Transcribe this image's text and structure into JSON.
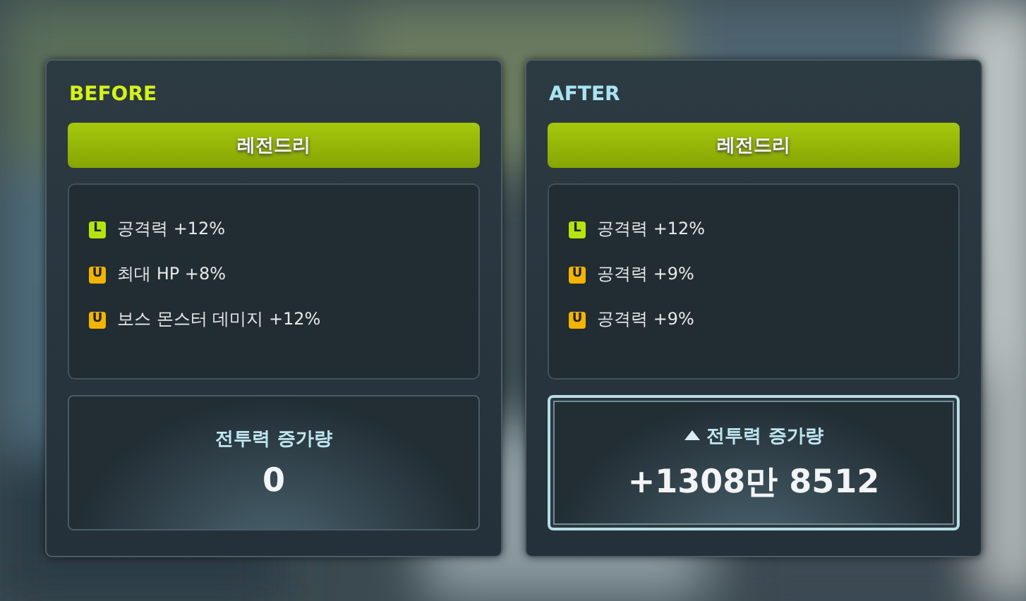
{
  "panels": [
    {
      "kind": "before",
      "title": "BEFORE",
      "grade": "레전드리",
      "options": [
        {
          "kind": "legendary",
          "badge": "L",
          "text": "공격력 +12%"
        },
        {
          "kind": "unique",
          "badge": "U",
          "text": "최대 HP +8%"
        },
        {
          "kind": "unique",
          "badge": "U",
          "text": "보스 몬스터 데미지 +12%"
        }
      ],
      "power": {
        "increase": false,
        "label": "전투력 증가량",
        "value": "0"
      }
    },
    {
      "kind": "after",
      "title": "AFTER",
      "grade": "레전드리",
      "options": [
        {
          "kind": "legendary",
          "badge": "L",
          "text": "공격력 +12%"
        },
        {
          "kind": "unique",
          "badge": "U",
          "text": "공격력 +9%"
        },
        {
          "kind": "unique",
          "badge": "U",
          "text": "공격력 +9%"
        }
      ],
      "power": {
        "increase": true,
        "label": "전투력 증가량",
        "value": "+1308만 8512"
      }
    }
  ]
}
